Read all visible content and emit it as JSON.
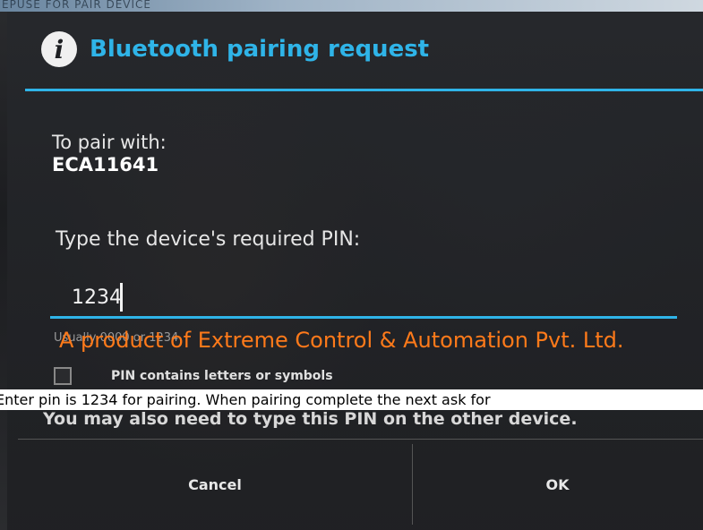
{
  "top_strip": {
    "text": "EPUSE  FOR  PAIR  DEVICE"
  },
  "dialog": {
    "title": "Bluetooth pairing request",
    "pair_label": "To pair with:",
    "device_name": "ECA11641",
    "pin_label": "Type the device's required PIN:",
    "pin_value": "1234",
    "hint_text": "Usually 0000 or 1234",
    "checkbox_label": "PIN contains letters or symbols",
    "other_device_note": "You may also need to type this PIN on the other device.",
    "buttons": {
      "cancel": "Cancel",
      "ok": "OK"
    }
  },
  "overlays": {
    "watermark": "A product of Extreme Control & Automation Pvt. Ltd.",
    "caption": "Enter pin is 1234 for pairing. When pairing complete the next ask for"
  },
  "colors": {
    "accent": "#2fb4e8",
    "watermark": "#ff7a1a"
  },
  "icons": {
    "title_icon": "info-icon"
  }
}
